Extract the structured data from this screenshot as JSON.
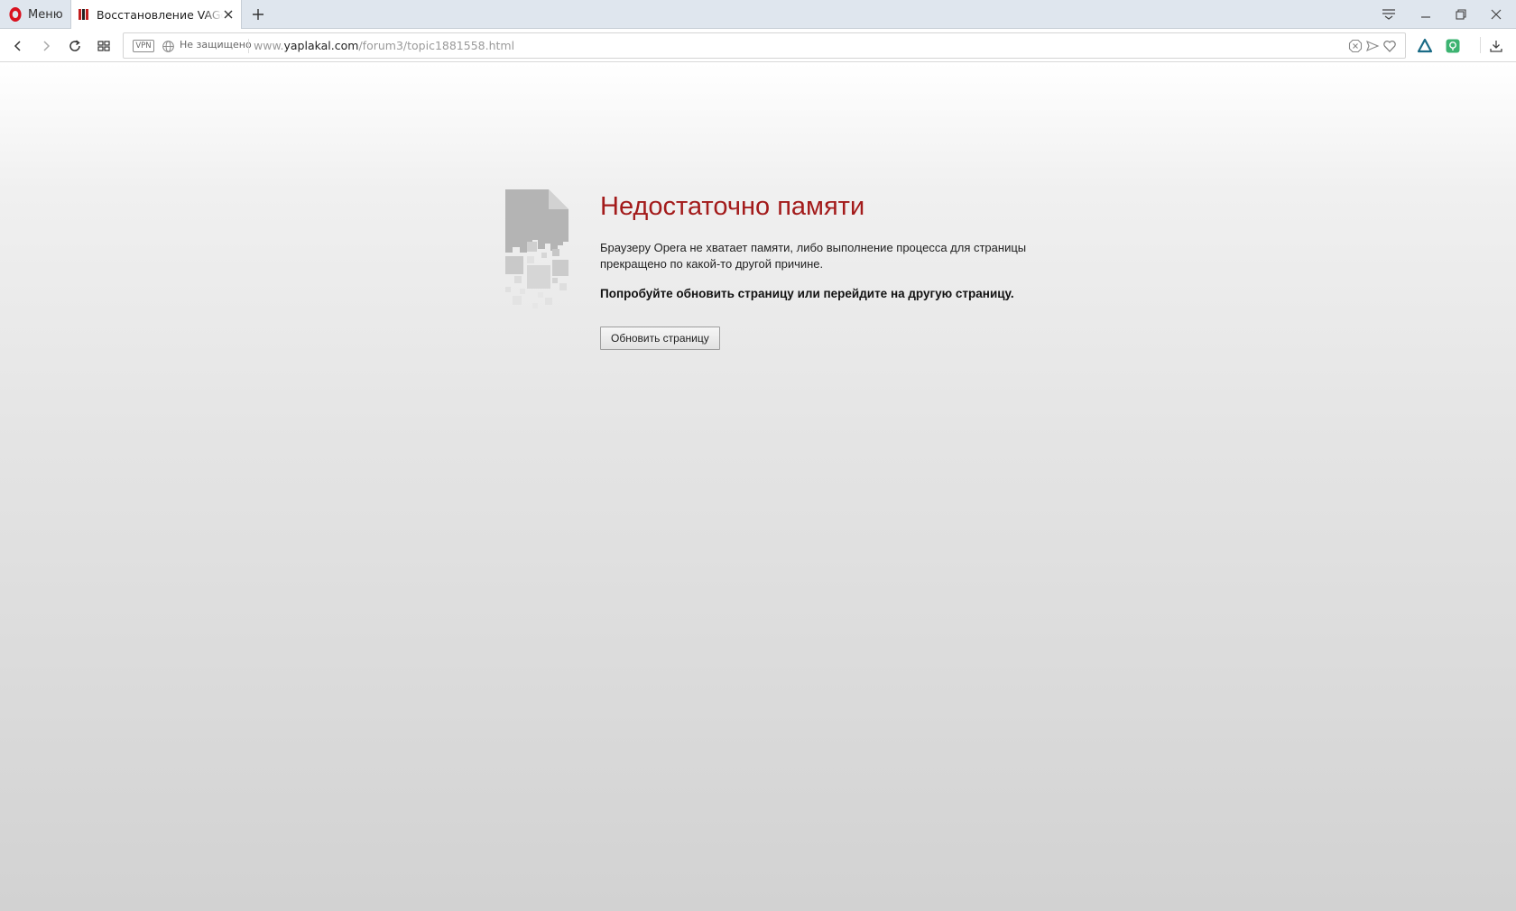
{
  "browser": {
    "menu_label": "Меню",
    "tab": {
      "title": "Восстановление VAGовск"
    },
    "address": {
      "vpn_label": "VPN",
      "security_label": "Не защищено",
      "url_prefix": "www.",
      "url_host": "yaplakal.com",
      "url_path": "/forum3/topic1881558.html"
    }
  },
  "error_page": {
    "title": "Недостаточно памяти",
    "description": "Браузеру Opera не хватает памяти, либо выполнение процесса для страницы прекращено по какой-то другой причине.",
    "hint": "Попробуйте обновить страницу или перейдите на другую страницу.",
    "reload_button": "Обновить страницу"
  },
  "colors": {
    "opera_red": "#d9121f",
    "error_title": "#a31b1b",
    "extension_green": "#3cb371",
    "aria_teal": "#1a6b86"
  }
}
